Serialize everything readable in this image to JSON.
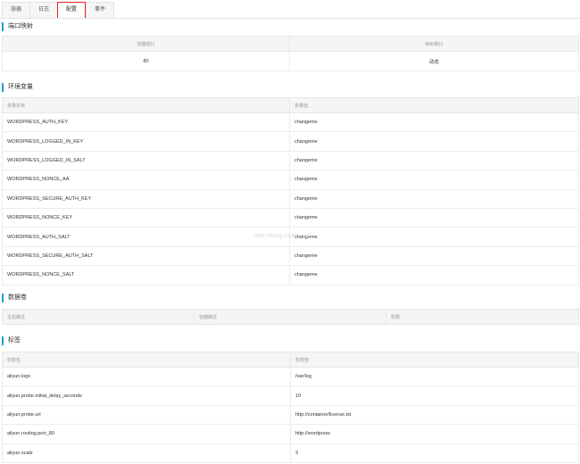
{
  "tabs": [
    "容器",
    "日志",
    "配置",
    "事件"
  ],
  "active_tab": 2,
  "sections": {
    "ports": {
      "title": "端口映射",
      "headers": [
        "容器端口",
        "映射端口"
      ],
      "rows": [
        [
          "80",
          "动态"
        ]
      ]
    },
    "env": {
      "title": "环境变量",
      "headers": [
        "变量名称",
        "变量值"
      ],
      "rows": [
        [
          "WORDPRESS_AUTH_KEY",
          "changeme"
        ],
        [
          "WORDPRESS_LOGGED_IN_KEY",
          "changeme"
        ],
        [
          "WORDPRESS_LOGGED_IN_SALT",
          "changeme"
        ],
        [
          "WORDPRESS_NONCE_AA",
          "changeme"
        ],
        [
          "WORDPRESS_SECURE_AUTH_KEY",
          "changeme"
        ],
        [
          "WORDPRESS_NONCE_KEY",
          "changeme"
        ],
        [
          "WORDPRESS_AUTH_SALT",
          "changeme"
        ],
        [
          "WORDPRESS_SECURE_AUTH_SALT",
          "changeme"
        ],
        [
          "WORDPRESS_NONCE_SALT",
          "changeme"
        ]
      ]
    },
    "volumes": {
      "title": "数据卷",
      "headers": [
        "主机路径",
        "容器路径",
        "权限"
      ]
    },
    "labels": {
      "title": "标签",
      "headers": [
        "标签名",
        "标签值"
      ],
      "rows": [
        [
          "aliyun.logs",
          "/var/log"
        ],
        [
          "aliyun.probe.initial_delay_seconds",
          "10"
        ],
        [
          "aliyun.probe.url",
          "http://container/license.txt"
        ],
        [
          "aliyun.routing.port_80",
          "http://wordpress"
        ],
        [
          "aliyun.scale",
          "3"
        ]
      ]
    }
  },
  "watermark": "http://blog.csdn.net/",
  "colors": {
    "active_tab_border": "#d9251d",
    "section_marker": "#1aa0d8",
    "header_bg": "#f5f5f5"
  }
}
